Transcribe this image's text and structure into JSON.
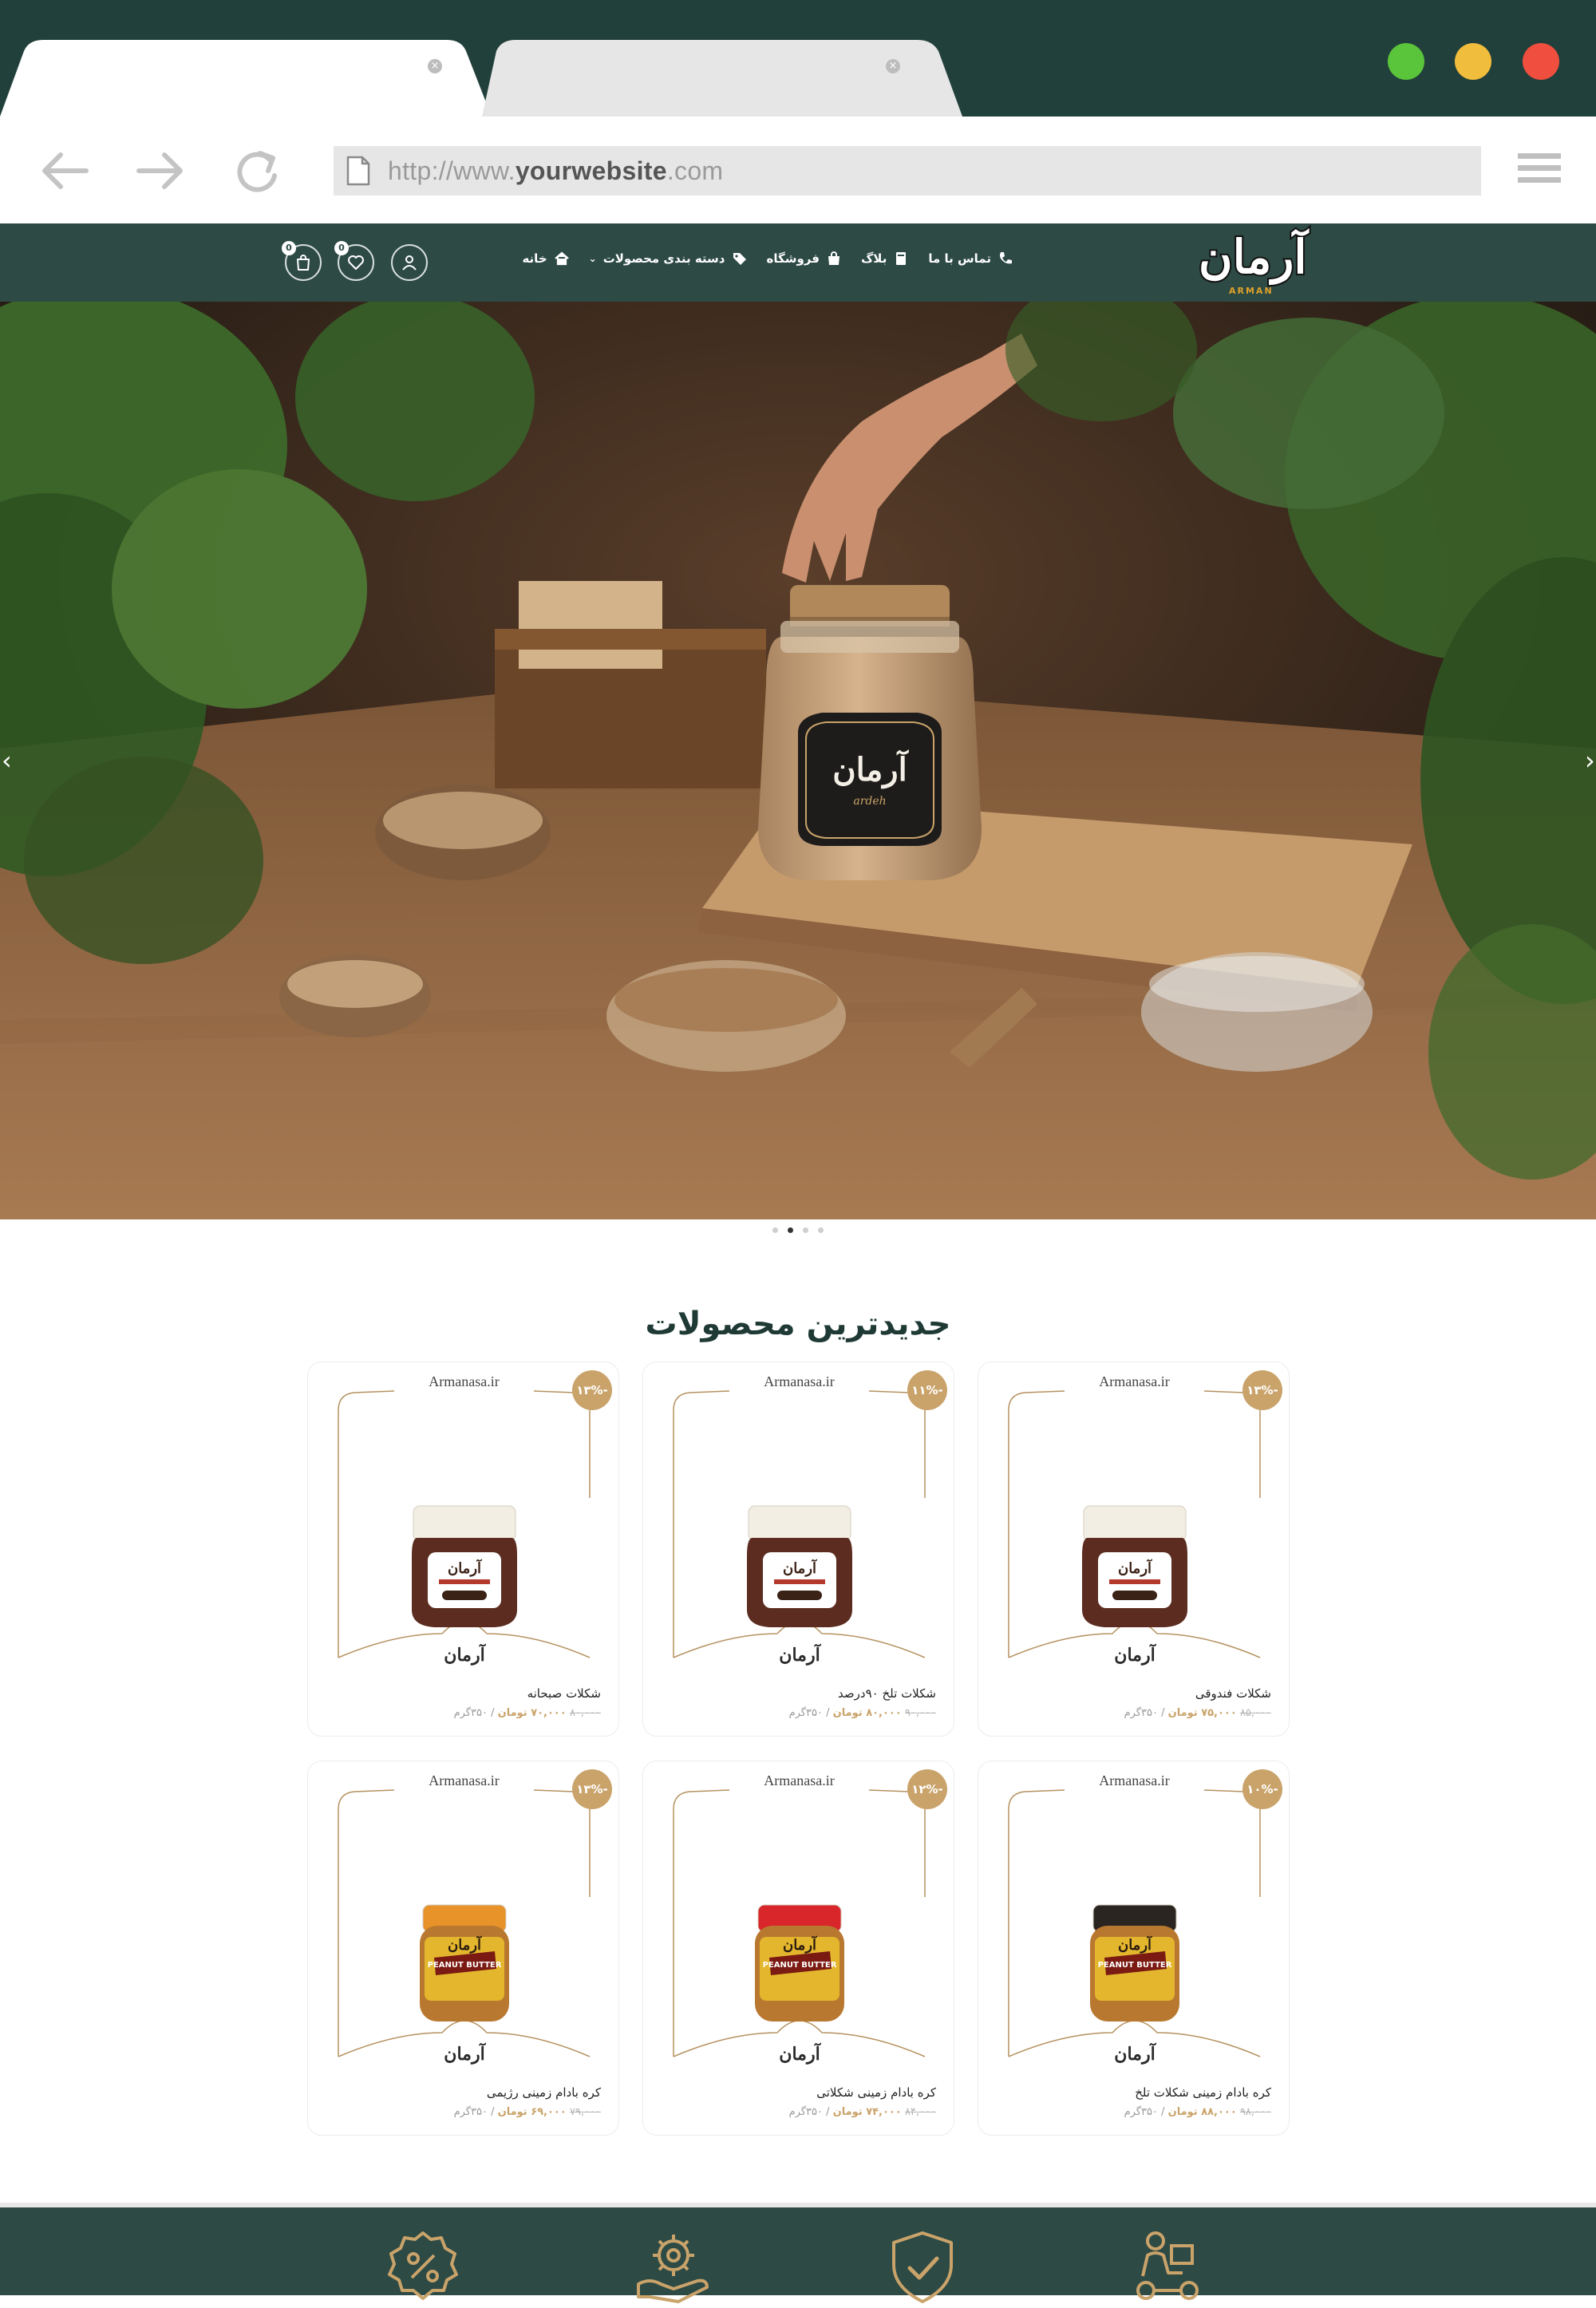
{
  "browser": {
    "url_prefix": "http://www.",
    "url_domain": "yourwebsite",
    "url_suffix": ".com",
    "tabs": [
      {
        "close": "×"
      },
      {
        "close": "×"
      }
    ],
    "window_buttons": [
      {
        "name": "maximize",
        "color": "#5ac43a"
      },
      {
        "name": "minimize",
        "color": "#f1bd3c"
      },
      {
        "name": "close",
        "color": "#f04e3e"
      }
    ]
  },
  "header": {
    "logo_text": "آرمان",
    "logo_sub": "ARMAN",
    "nav": [
      {
        "label": "خانه",
        "icon": "home-icon"
      },
      {
        "label": "دسته بندی محصولات",
        "icon": "tag-icon",
        "dropdown": "⌄"
      },
      {
        "label": "فروشگاه",
        "icon": "bag-icon"
      },
      {
        "label": "بلاگ",
        "icon": "book-icon"
      },
      {
        "label": "تماس با ما",
        "icon": "phone-icon"
      }
    ],
    "wishlist_count": "0",
    "cart_count": "0"
  },
  "hero": {
    "jar_label": "آرمان",
    "jar_sublabel": "ardeh",
    "prev": "‹",
    "next": "›",
    "slides": 4,
    "active_slide": 2
  },
  "products_section": {
    "title": "جدیدترین محصولات",
    "items": [
      {
        "domain": "Armanasa.ir",
        "discount": "-۱۳%",
        "name": "شکلات فندوقی",
        "old_price": "۸۵,۰۰۰",
        "new_price": "۷۵,۰۰۰ تومان",
        "weight": "/ ۳۵۰گرم",
        "jar": "chocolate",
        "lid": "#f3eee4"
      },
      {
        "domain": "Armanasa.ir",
        "discount": "-۱۱%",
        "name": "شکلات تلخ ۹۰درصد",
        "old_price": "۹۰,۰۰۰",
        "new_price": "۸۰,۰۰۰ تومان",
        "weight": "/ ۳۵۰گرم",
        "jar": "chocolate",
        "lid": "#f3eee4"
      },
      {
        "domain": "Armanasa.ir",
        "discount": "-۱۳%",
        "name": "شکلات صبحانه",
        "old_price": "۸۰,۰۰۰",
        "new_price": "۷۰,۰۰۰ تومان",
        "weight": "/ ۳۵۰گرم",
        "jar": "chocolate",
        "lid": "#f3eee4"
      },
      {
        "domain": "Armanasa.ir",
        "discount": "-۱۰%",
        "name": "کره بادام زمینی شکلات تلخ",
        "old_price": "۹۸,۰۰۰",
        "new_price": "۸۸,۰۰۰ تومان",
        "weight": "/ ۳۵۰گرم",
        "jar": "peanut",
        "lid": "#2a2521"
      },
      {
        "domain": "Armanasa.ir",
        "discount": "-۱۲%",
        "name": "کره بادام زمینی شکلاتی",
        "old_price": "۸۴,۰۰۰",
        "new_price": "۷۴,۰۰۰ تومان",
        "weight": "/ ۳۵۰گرم",
        "jar": "peanut",
        "lid": "#d8262b"
      },
      {
        "domain": "Armanasa.ir",
        "discount": "-۱۳%",
        "name": "کره بادام زمینی رژیمی",
        "old_price": "۷۹,۰۰۰",
        "new_price": "۶۹,۰۰۰ تومان",
        "weight": "/ ۳۵۰گرم",
        "jar": "peanut",
        "lid": "#e8922a"
      }
    ]
  },
  "footer_features": [
    {
      "icon": "discount-badge-icon"
    },
    {
      "icon": "support-gear-icon"
    },
    {
      "icon": "shield-check-icon"
    },
    {
      "icon": "delivery-courier-icon"
    }
  ],
  "colors": {
    "chrome": "#22403b",
    "header": "#2d4a45",
    "accent_gold": "#c9a36a",
    "title": "#1f3a35"
  }
}
